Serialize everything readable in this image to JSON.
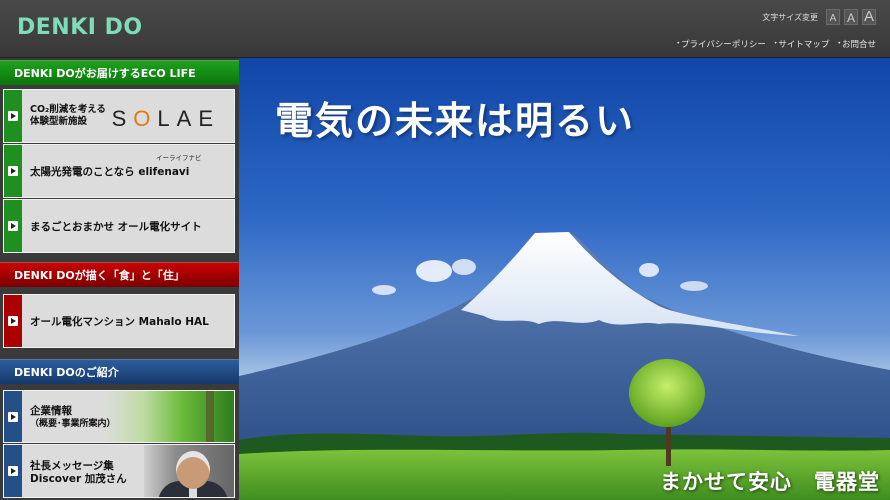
{
  "header": {
    "logo": "DENKI DO",
    "fontsize_label": "文字サイズ変更",
    "fontsize_buttons": [
      "A",
      "A",
      "A"
    ],
    "links": [
      "プライバシーポリシー",
      "サイトマップ",
      "お問合せ"
    ]
  },
  "sidebar": {
    "eco": {
      "heading": "DENKI DOがお届けするECO LIFE",
      "items": [
        {
          "line1": "CO₂削減を考える",
          "line2": "体験型新施設",
          "brand": "SOLAE"
        },
        {
          "label": "太陽光発電のことなら elifenavi",
          "ruby": "イーライフナビ"
        },
        {
          "label": "まるごとおまかせ オール電化サイト"
        }
      ]
    },
    "living": {
      "heading": "DENKI DOが描く「食」と「住」",
      "items": [
        {
          "label": "オール電化マンション Mahalo HAL"
        }
      ]
    },
    "about": {
      "heading": "DENKI DOのご紹介",
      "items": [
        {
          "line1": "企業情報",
          "line2": "（概要･事業所案内）"
        },
        {
          "line1": "社長メッセージ集",
          "line2": "Discover 加茂さん"
        }
      ]
    }
  },
  "hero": {
    "title": "電気の未来は明るい",
    "tagline": "まかせて安心　電器堂"
  },
  "colors": {
    "logo": "#7fdcb9",
    "eco_green": "#1fa21f",
    "living_red": "#cc0000",
    "about_blue": "#2c5d9c",
    "solae_accent": "#e07b1d"
  }
}
